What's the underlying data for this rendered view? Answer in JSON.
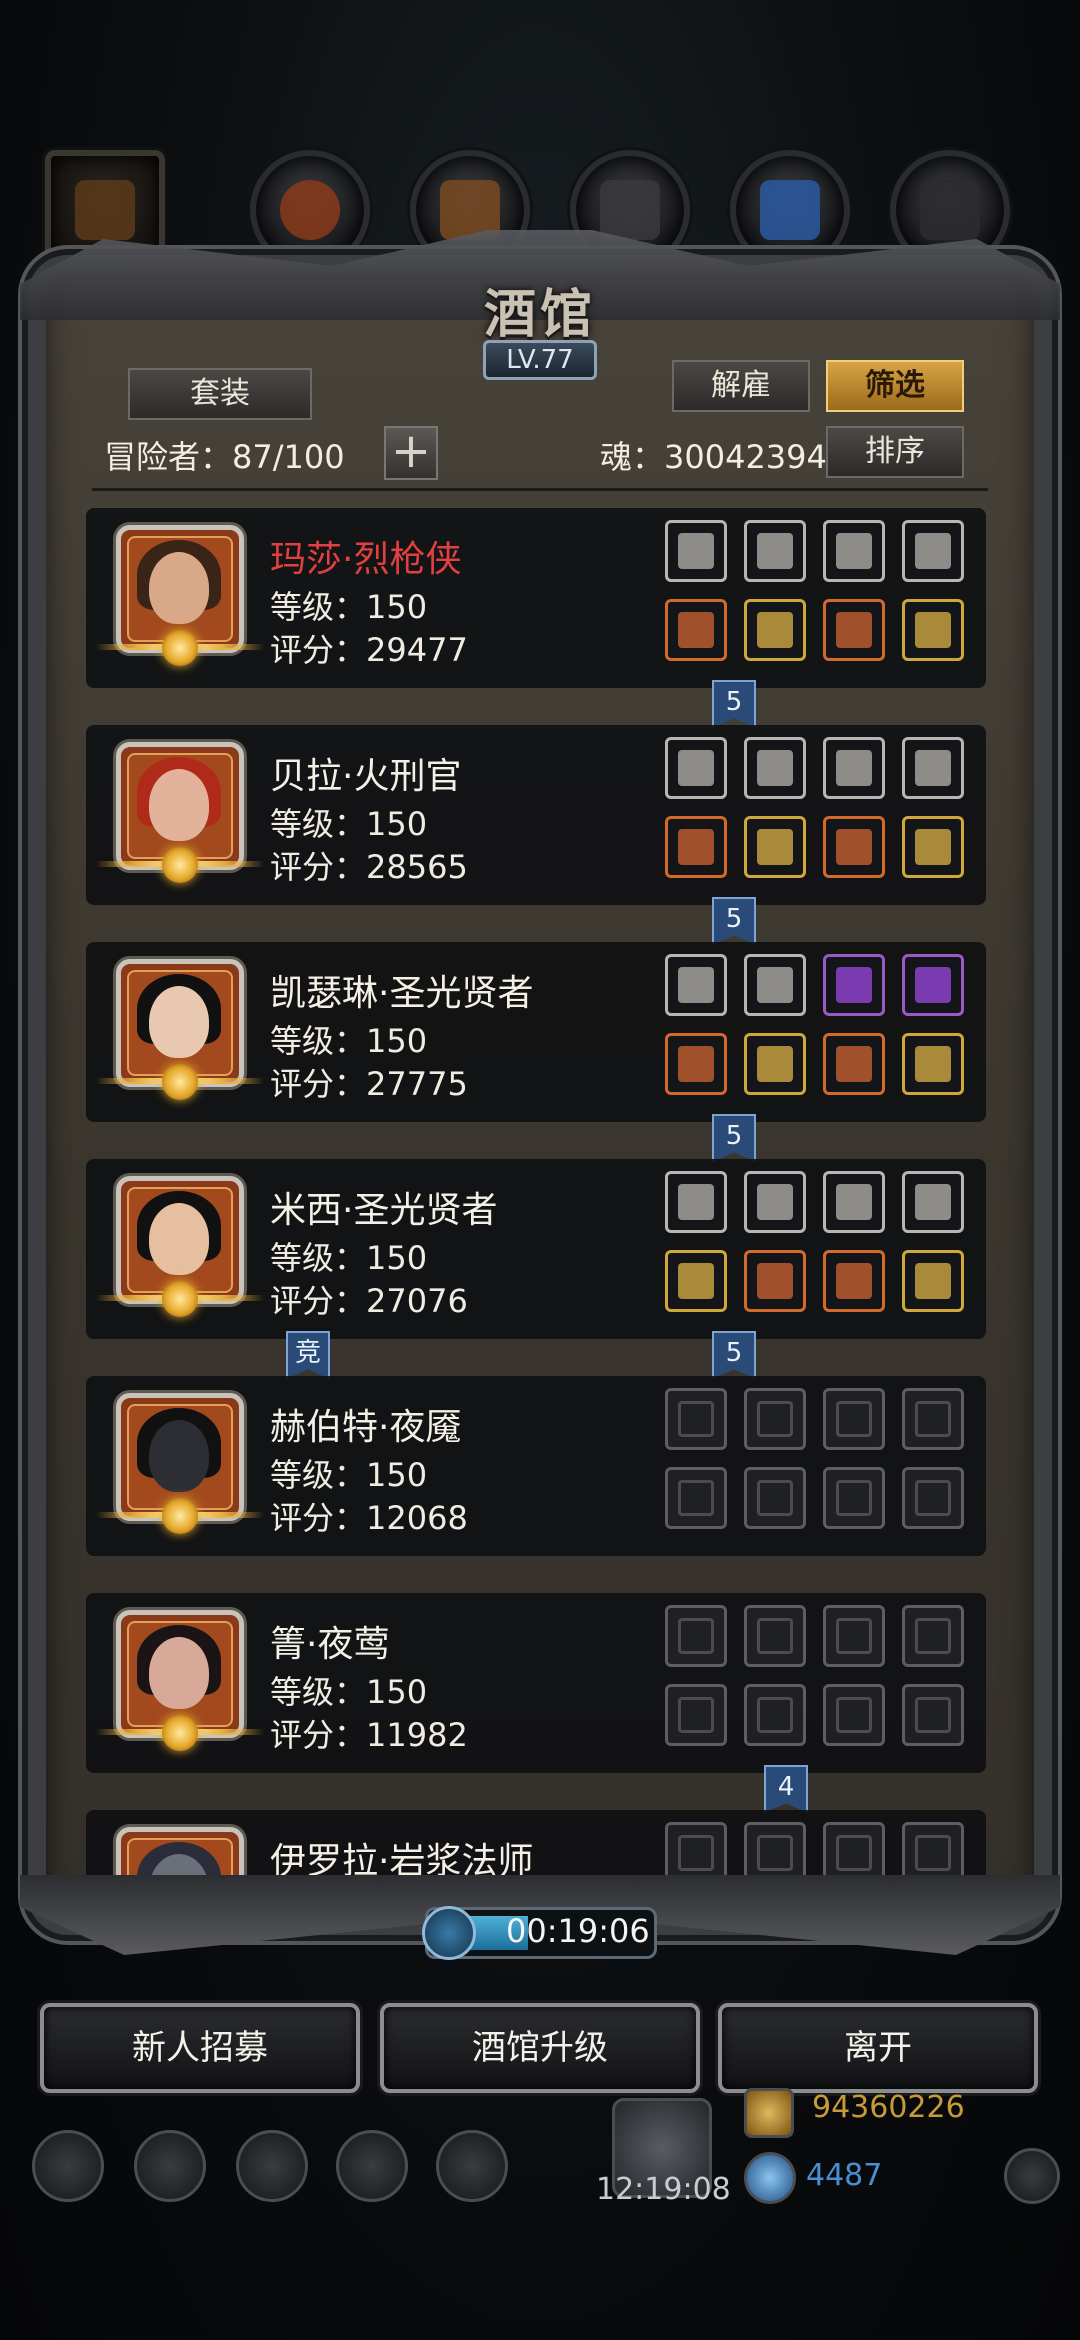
{
  "tavern": {
    "title": "酒馆",
    "level": "LV.77",
    "set_button": "套装",
    "dismiss_button": "解雇",
    "filter_button": "筛选",
    "sort_button": "排序",
    "adventurers_label": "冒险者：87/100",
    "plus_button": "+",
    "soul_label": "魂：30042394"
  },
  "heroes": [
    {
      "name": "玛莎·烈枪侠",
      "level": "等级：150",
      "score": "评分：29477",
      "name_color": "#e04040",
      "badge": "5",
      "equip": [
        {
          "icon": "helmet-icon",
          "tier": "white"
        },
        {
          "icon": "crystal-icon",
          "tier": "white"
        },
        {
          "icon": "horn-icon",
          "tier": "white"
        },
        {
          "icon": "wand-icon",
          "tier": "white"
        },
        {
          "icon": "musket-icon",
          "tier": "orange"
        },
        {
          "icon": "cloak-icon",
          "tier": "gold"
        },
        {
          "icon": "sword-icon",
          "tier": "orange"
        },
        {
          "icon": "amulet-icon",
          "tier": "gold"
        }
      ]
    },
    {
      "name": "贝拉·火刑官",
      "level": "等级：150",
      "score": "评分：28565",
      "badge": "5",
      "equip": [
        {
          "icon": "helmet-icon",
          "tier": "white"
        },
        {
          "icon": "gem-icon",
          "tier": "white"
        },
        {
          "icon": "feather-icon",
          "tier": "white"
        },
        {
          "icon": "feather-icon",
          "tier": "white"
        },
        {
          "icon": "axe-icon",
          "tier": "orange"
        },
        {
          "icon": "armor-icon",
          "tier": "gold"
        },
        {
          "icon": "demon-mask-icon",
          "tier": "orange"
        },
        {
          "icon": "scroll-icon",
          "tier": "gold"
        }
      ]
    },
    {
      "name": "凯瑟琳·圣光贤者",
      "level": "等级：150",
      "score": "评分：27775",
      "badge": "5",
      "equip": [
        {
          "icon": "helmet-icon",
          "tier": "white"
        },
        {
          "icon": "orb-icon",
          "tier": "white"
        },
        {
          "icon": "amethyst-icon",
          "tier": "purple"
        },
        {
          "icon": "relic-icon",
          "tier": "purple"
        },
        {
          "icon": "gauntlet-icon",
          "tier": "orange"
        },
        {
          "icon": "armor-icon",
          "tier": "gold"
        },
        {
          "icon": "demon-mask-icon",
          "tier": "orange"
        },
        {
          "icon": "ring-icon",
          "tier": "gold"
        }
      ]
    },
    {
      "name": "米西·圣光贤者",
      "level": "等级：150",
      "score": "评分：27076",
      "badge": "5",
      "side_badge": "竞",
      "equip": [
        {
          "icon": "helmet-icon",
          "tier": "white"
        },
        {
          "icon": "orb-icon",
          "tier": "white"
        },
        {
          "icon": "ruby-icon",
          "tier": "white"
        },
        {
          "icon": "lantern-icon",
          "tier": "white"
        },
        {
          "icon": "staff-icon",
          "tier": "gold"
        },
        {
          "icon": "armor-icon",
          "tier": "orange"
        },
        {
          "icon": "potion-icon",
          "tier": "orange"
        },
        {
          "icon": "mace-icon",
          "tier": "gold"
        }
      ]
    },
    {
      "name": "赫伯特·夜魇",
      "level": "等级：150",
      "score": "评分：12068",
      "equip": [
        {
          "icon": "helmet-slot-icon",
          "tier": "empty"
        },
        {
          "icon": "flame-slot-icon",
          "tier": "empty"
        },
        {
          "icon": "hourglass-slot-icon",
          "tier": "empty"
        },
        {
          "icon": "hourglass-slot-icon",
          "tier": "empty"
        },
        {
          "icon": "blade-slot-icon",
          "tier": "empty"
        },
        {
          "icon": "armor-slot-icon",
          "tier": "empty"
        },
        {
          "icon": "ring-slot-icon",
          "tier": "empty"
        },
        {
          "icon": "ring-slot-icon",
          "tier": "empty"
        }
      ]
    },
    {
      "name": "箐·夜莺",
      "level": "等级：150",
      "score": "评分：11982",
      "badge": "4",
      "equip": [
        {
          "icon": "helmet-slot-icon",
          "tier": "empty"
        },
        {
          "icon": "flame-slot-icon",
          "tier": "empty"
        },
        {
          "icon": "hourglass-slot-icon",
          "tier": "empty"
        },
        {
          "icon": "hourglass-slot-icon",
          "tier": "empty"
        },
        {
          "icon": "blade-slot-icon",
          "tier": "empty"
        },
        {
          "icon": "armor-slot-icon",
          "tier": "empty"
        },
        {
          "icon": "ring-slot-icon",
          "tier": "empty"
        },
        {
          "icon": "ring-slot-icon",
          "tier": "empty"
        }
      ]
    },
    {
      "name": "伊罗拉·岩浆法师",
      "level": "",
      "score": "",
      "equip": [
        {
          "icon": "helmet-slot-icon",
          "tier": "empty"
        },
        {
          "icon": "flame-slot-icon",
          "tier": "empty"
        },
        {
          "icon": "hourglass-slot-icon",
          "tier": "empty"
        },
        {
          "icon": "hourglass-slot-icon",
          "tier": "empty"
        }
      ]
    }
  ],
  "timer": {
    "value": "00:19:06"
  },
  "bottom_buttons": {
    "recruit": "新人招募",
    "upgrade": "酒馆升级",
    "leave": "离开"
  },
  "hud": {
    "clock": "12:19:08",
    "gold": "94360226",
    "gems": "4487",
    "gold_color": "#c99a3a",
    "gems_color": "#4a8fd0"
  }
}
